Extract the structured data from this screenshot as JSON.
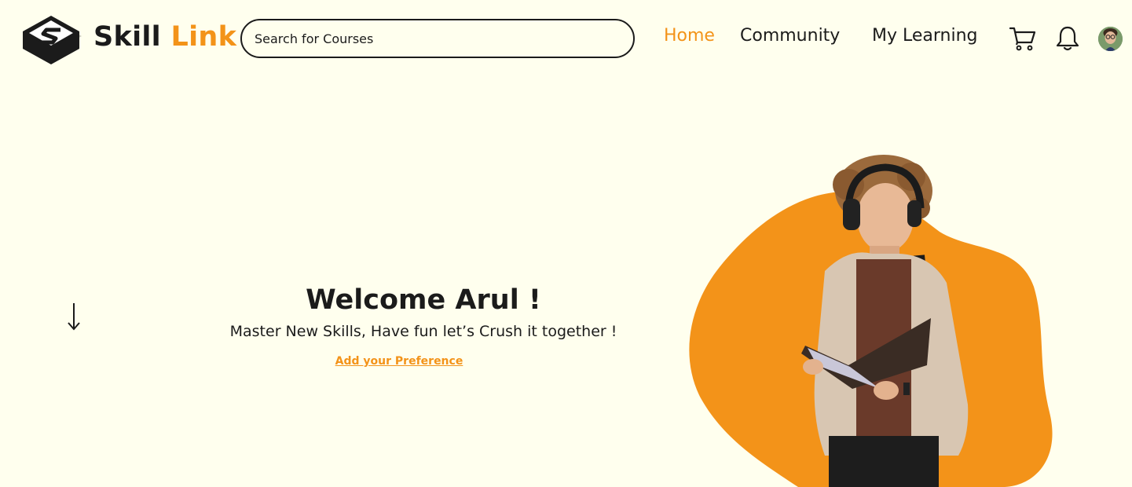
{
  "header": {
    "brand_part1": "Skill",
    "brand_part2": "Link",
    "search_placeholder": "Search for Courses",
    "nav": {
      "home": "Home",
      "community": "Community",
      "my_learning": "My Learning"
    },
    "icons": [
      "cart-icon",
      "bell-icon",
      "avatar"
    ]
  },
  "hero": {
    "welcome": "Welcome Arul !",
    "tagline": "Master New Skills, Have fun let’s Crush it together !",
    "preference_link": "Add your Preference"
  },
  "colors": {
    "background": "#FFFFEE",
    "accent": "#F39319",
    "text": "#1b1b1b"
  }
}
